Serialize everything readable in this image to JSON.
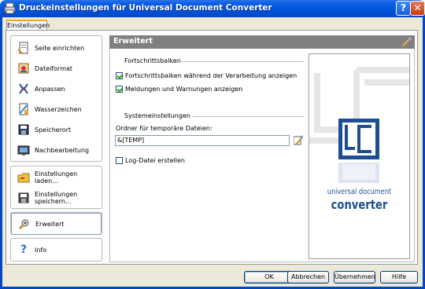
{
  "window": {
    "title": "Druckeinstellungen für Universal Document Converter",
    "help_label": "?",
    "close_label": "✕"
  },
  "tab": {
    "label": "Einstellungen"
  },
  "nav": {
    "group1": [
      {
        "label": "Seite einrichten",
        "icon": "page-setup-icon"
      },
      {
        "label": "Dateiformat",
        "icon": "file-format-icon"
      },
      {
        "label": "Anpassen",
        "icon": "adjust-icon"
      },
      {
        "label": "Wasserzeichen",
        "icon": "watermark-icon"
      },
      {
        "label": "Speicherort",
        "icon": "save-location-icon"
      },
      {
        "label": "Nachbearbeitung",
        "icon": "post-processing-icon"
      }
    ],
    "group2": [
      {
        "label": "Einstellungen laden...",
        "icon": "load-settings-icon"
      },
      {
        "label": "Einstellungen speichern...",
        "icon": "save-settings-icon"
      }
    ],
    "active": {
      "label": "Erweitert",
      "icon": "advanced-icon"
    },
    "info": {
      "label": "Info",
      "icon": "help-icon"
    }
  },
  "panel": {
    "title": "Erweitert",
    "progress_section": "Fortschrittsbalken",
    "cb_progress": {
      "label": "Fortschrittsbalken während der Verarbeitung anzeigen",
      "checked": true
    },
    "cb_messages": {
      "label": "Meldungen und Warnungen anzeigen",
      "checked": true
    },
    "system_section": "Systemeinstellungen",
    "temp_label": "Ordner für temporäre Dateien:",
    "temp_value": "&[TEMP]",
    "cb_log": {
      "label": "Log-Datei erstellen",
      "checked": false
    },
    "logo_line1": "universal document",
    "logo_line2": "converter"
  },
  "buttons": {
    "ok": "OK",
    "cancel": "Abbrechen",
    "apply": "Übernehmen",
    "help": "Hilfe"
  },
  "colors": {
    "titlebar": "#0050d6",
    "panel_header": "#808080",
    "logo_blue": "#1d4e8f"
  }
}
